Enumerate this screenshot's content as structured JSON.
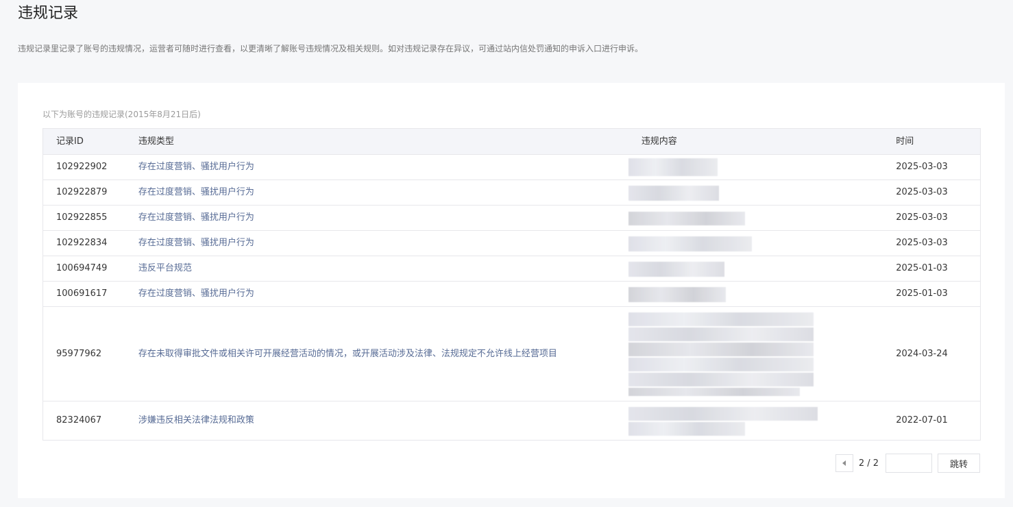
{
  "page": {
    "title": "违规记录",
    "description": "违规记录里记录了账号的违规情况，运营者可随时进行查看，以更清晰了解账号违规情况及相关规则。如对违规记录存在异议，可通过站内信处罚通知的申诉入口进行申诉。"
  },
  "card": {
    "caption": "以下为账号的违规记录(2015年8月21日后)"
  },
  "table": {
    "headers": {
      "id": "记录ID",
      "type": "违规类型",
      "content": "违规内容",
      "time": "时间"
    },
    "rows": [
      {
        "id": "102922902",
        "type": "存在过度营销、骚扰用户行为",
        "time": "2025-03-03"
      },
      {
        "id": "102922879",
        "type": "存在过度营销、骚扰用户行为",
        "time": "2025-03-03"
      },
      {
        "id": "102922855",
        "type": "存在过度营销、骚扰用户行为",
        "time": "2025-03-03"
      },
      {
        "id": "102922834",
        "type": "存在过度营销、骚扰用户行为",
        "time": "2025-03-03"
      },
      {
        "id": "100694749",
        "type": "违反平台规范",
        "time": "2025-01-03"
      },
      {
        "id": "100691617",
        "type": "存在过度营销、骚扰用户行为",
        "time": "2025-01-03"
      },
      {
        "id": "95977962",
        "type": "存在未取得审批文件或相关许可开展经营活动的情况，或开展活动涉及法律、法规规定不允许线上经营项目",
        "time": "2024-03-24"
      },
      {
        "id": "82324067",
        "type": "涉嫌违反相关法律法规和政策",
        "time": "2022-07-01"
      }
    ]
  },
  "pager": {
    "label": "2 / 2",
    "input_value": "",
    "go_label": "跳转"
  }
}
